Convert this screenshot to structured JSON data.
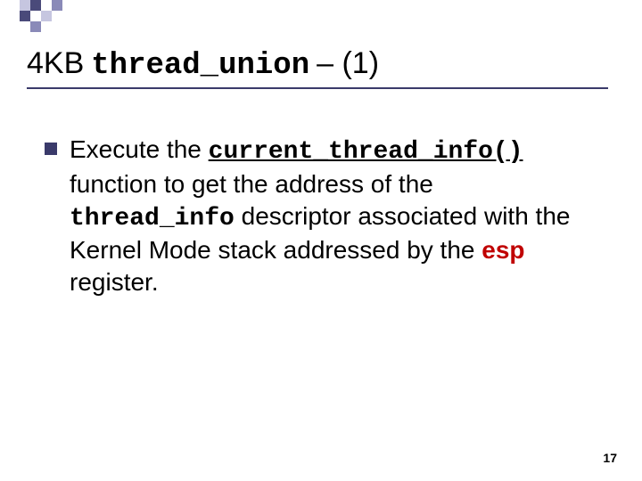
{
  "title": {
    "prefix": "4KB",
    "code": "thread_union",
    "suffix": "– (1)"
  },
  "bullet": {
    "t1": "Execute the ",
    "func": "current_thread_info()",
    "t2": " function to get the address of the ",
    "desc": "thread_info",
    "t3": " descriptor associated with the Kernel Mode stack addressed by the ",
    "reg": "esp",
    "t4": " register."
  },
  "page_number": "17"
}
